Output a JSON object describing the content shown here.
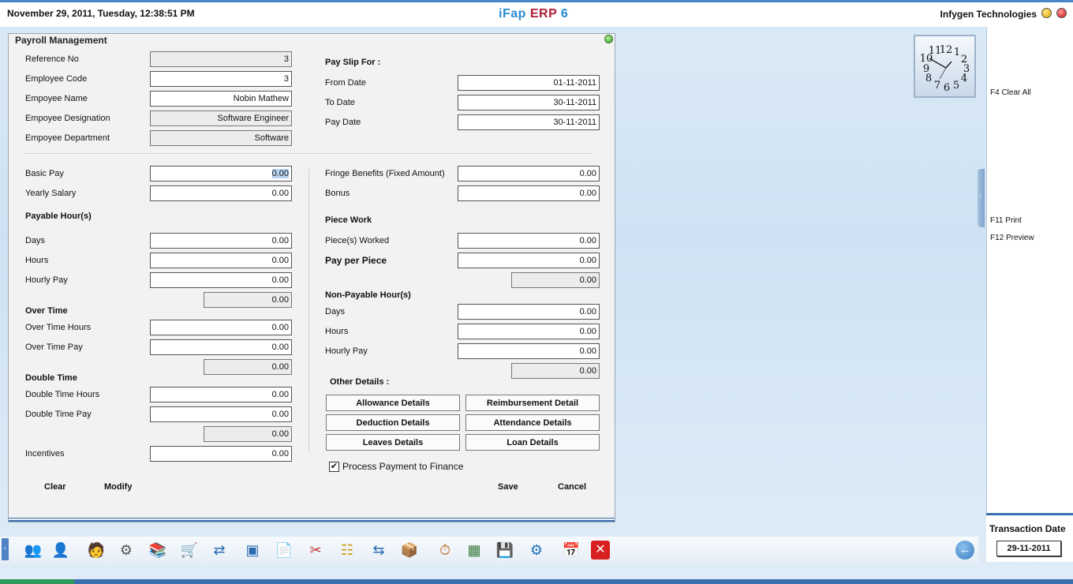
{
  "header": {
    "datetime": "November  29, 2011, Tuesday, 12:38:51 PM",
    "brand_part1": "iFap",
    "brand_part2": "ERP",
    "brand_part3": "6",
    "company": "Infygen Technologies"
  },
  "panel": {
    "title": "Payroll Management",
    "employee": {
      "reference_no_label": "Reference No",
      "reference_no": "3",
      "employee_code_label": "Employee Code",
      "employee_code": "3",
      "employee_name_label": "Empoyee Name",
      "employee_name": "Nobin Mathew",
      "designation_label": "Empoyee Designation",
      "designation": "Software Engineer",
      "department_label": "Empoyee Department",
      "department": "Software"
    },
    "payslip": {
      "heading": "Pay Slip For :",
      "from_date_label": "From Date",
      "from_date": "01-11-2011",
      "to_date_label": "To Date",
      "to_date": "30-11-2011",
      "pay_date_label": "Pay Date",
      "pay_date": "30-11-2011"
    },
    "left": {
      "basic_pay_label": "Basic Pay",
      "basic_pay": "0.00",
      "yearly_salary_label": "Yearly Salary",
      "yearly_salary": "0.00",
      "payable_heading": "Payable Hour(s)",
      "days_label": "Days",
      "days": "0.00",
      "hours_label": "Hours",
      "hours": "0.00",
      "hourly_pay_label": "Hourly Pay",
      "hourly_pay": "0.00",
      "payable_total": "0.00",
      "overtime_heading": "Over Time",
      "ot_hours_label": "Over Time Hours",
      "ot_hours": "0.00",
      "ot_pay_label": "Over Time Pay",
      "ot_pay": "0.00",
      "ot_total": "0.00",
      "double_heading": "Double Time",
      "dt_hours_label": "Double Time Hours",
      "dt_hours": "0.00",
      "dt_pay_label": "Double Time Pay",
      "dt_pay": "0.00",
      "dt_total": "0.00",
      "incentives_label": "Incentives",
      "incentives": "0.00"
    },
    "right": {
      "fringe_label": "Fringe Benefits (Fixed Amount)",
      "fringe": "0.00",
      "bonus_label": "Bonus",
      "bonus": "0.00",
      "piece_heading": "Piece Work",
      "pieces_label": "Piece(s) Worked",
      "pieces": "0.00",
      "pay_per_piece_label": "Pay per Piece",
      "pay_per_piece": "0.00",
      "piece_total": "0.00",
      "nonpay_heading": "Non-Payable Hour(s)",
      "np_days_label": "Days",
      "np_days": "0.00",
      "np_hours_label": "Hours",
      "np_hours": "0.00",
      "np_hourly_label": "Hourly Pay",
      "np_hourly": "0.00",
      "np_total": "0.00",
      "other_heading": "Other Details :"
    },
    "detail_buttons": {
      "allowance": "Allowance Details",
      "reimbursement": "Reimbursement Detail",
      "deduction": "Deduction Details",
      "attendance": "Attendance Details",
      "leaves": "Leaves Details",
      "loan": "Loan Details"
    },
    "process_payment_label": "Process Payment to Finance",
    "process_payment_checked": "✔",
    "actions": {
      "clear": "Clear",
      "modify": "Modify",
      "save": "Save",
      "cancel": "Cancel"
    }
  },
  "function_keys": {
    "clear_all": "F4 Clear All",
    "print": "F11 Print",
    "preview": "F12 Preview"
  },
  "transaction": {
    "label": "Transaction Date",
    "date": "29-11-2011"
  },
  "toolbar": {
    "icons": [
      "people-icon",
      "user-icon",
      "employee-icon",
      "gears-icon",
      "books-icon",
      "cart-icon",
      "transfer-icon",
      "window-icon",
      "document-icon",
      "tools-icon",
      "hierarchy-icon",
      "exchange-icon",
      "package-icon",
      "timer-icon",
      "calculator-sheet-icon",
      "save-icon",
      "settings-icon",
      "calendar-icon",
      "exit-icon"
    ]
  }
}
